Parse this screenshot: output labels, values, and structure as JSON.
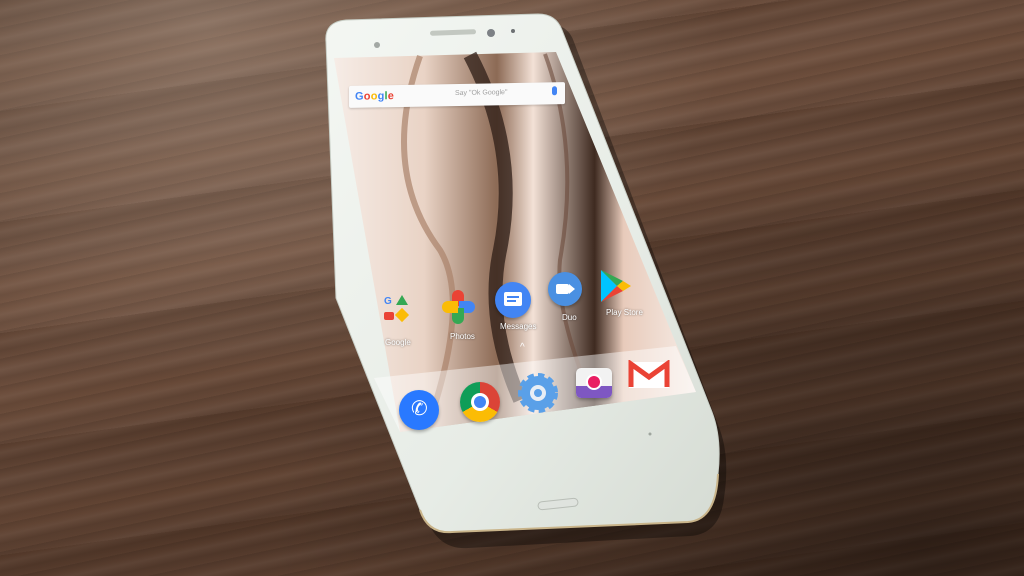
{
  "scene": {
    "description_icons": [
      "google-folder-icon",
      "photos-icon",
      "messages-icon",
      "duo-icon",
      "play-store-icon",
      "phone-icon",
      "chrome-icon",
      "settings-icon",
      "camera-icon",
      "gmail-icon"
    ],
    "colors": {
      "table": "#5e4333",
      "phone_body": "#eef2ee",
      "google_blue": "#4285f4",
      "google_red": "#ea4335",
      "google_yellow": "#fbbc05",
      "google_green": "#34a853"
    }
  },
  "screen": {
    "status_time": "",
    "search": {
      "logo": "Google",
      "hint": "Say \"Ok Google\""
    },
    "home_apps": [
      {
        "label": "Google"
      },
      {
        "label": "Photos"
      },
      {
        "label": "Messages"
      },
      {
        "label": "Duo"
      },
      {
        "label": "Play Store"
      }
    ]
  }
}
